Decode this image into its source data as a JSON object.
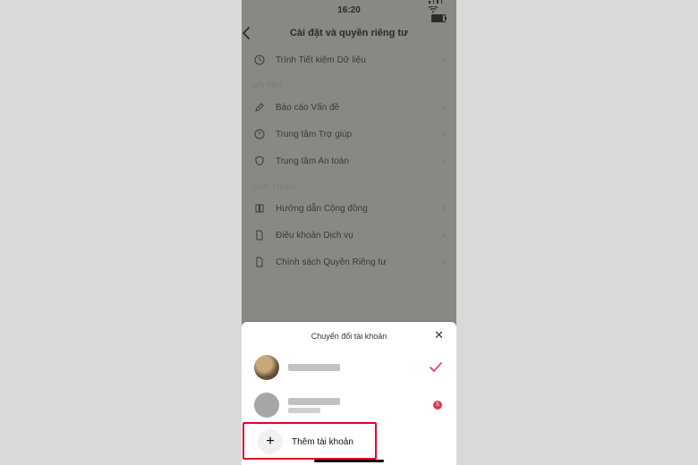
{
  "status": {
    "time": "16:20"
  },
  "header": {
    "title": "Cài đặt và quyền riêng tư"
  },
  "rows": {
    "data_saver": "Trình Tiết kiệm Dữ liệu",
    "report": "Báo cáo Vấn đề",
    "help": "Trung tâm Trợ giúp",
    "safety": "Trung tâm An toàn",
    "guidelines": "Hướng dẫn Cộng đồng",
    "terms": "Điều khoản Dịch vụ",
    "privacy": "Chính sách Quyền Riêng tư"
  },
  "sections": {
    "support": "HỖ TRỢ",
    "about": "GIỚI THIỆU"
  },
  "sheet": {
    "title": "Chuyển đổi tài khoản",
    "add_label": "Thêm tài khoản",
    "badge": "5"
  }
}
